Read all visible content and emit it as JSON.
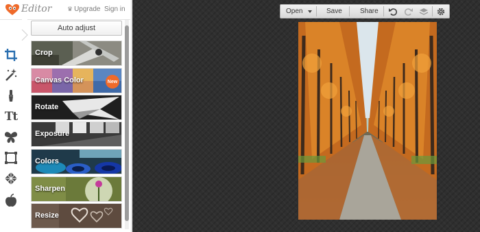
{
  "app": {
    "title": "Editor",
    "upgrade_label": "Upgrade",
    "signin_label": "Sign in",
    "logo_icon": "heart-logo-icon"
  },
  "tool_rail": [
    {
      "name": "crop-tool-icon",
      "active": true
    },
    {
      "name": "magic-wand-icon"
    },
    {
      "name": "paint-brush-icon"
    },
    {
      "name": "text-tool-icon",
      "glyph": "Tt"
    },
    {
      "name": "butterfly-icon"
    },
    {
      "name": "frame-icon"
    },
    {
      "name": "texture-icon"
    },
    {
      "name": "apple-icon"
    }
  ],
  "panel": {
    "auto_adjust_label": "Auto adjust",
    "tools": [
      {
        "label": "Crop"
      },
      {
        "label": "Canvas Color",
        "badge": "New"
      },
      {
        "label": "Rotate"
      },
      {
        "label": "Exposure"
      },
      {
        "label": "Colors"
      },
      {
        "label": "Sharpen"
      },
      {
        "label": "Resize"
      }
    ]
  },
  "toolbar": {
    "open_label": "Open",
    "save_label": "Save",
    "share_label": "Share",
    "icons": [
      "undo-icon",
      "redo-icon",
      "layers-icon",
      "settings-gear-icon"
    ]
  },
  "colors": {
    "accent_orange": "#ef6a2a",
    "canvas_bg": "#2f2f2f",
    "active_tool": "#2a6fb0"
  }
}
